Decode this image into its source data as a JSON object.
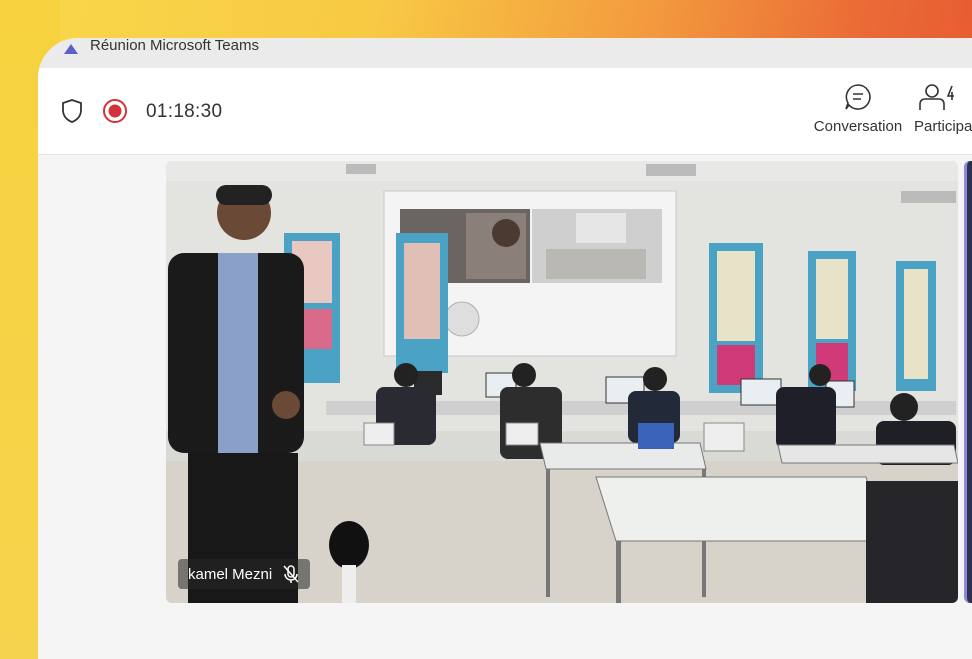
{
  "window": {
    "title": "Réunion Microsoft Teams"
  },
  "toolbar": {
    "timer": "01:18:30",
    "conversation_label": "Conversation",
    "participants_label": "Participa"
  },
  "video": {
    "participant_name": "kamel Mezni"
  },
  "icons": [
    "teams-app-icon",
    "shield-icon",
    "recording-icon",
    "chat-icon",
    "people-icon",
    "mic-off-icon"
  ],
  "colors": {
    "recording": "#d13438",
    "background_top": "#f8c944",
    "background_right": "#e4502f"
  }
}
